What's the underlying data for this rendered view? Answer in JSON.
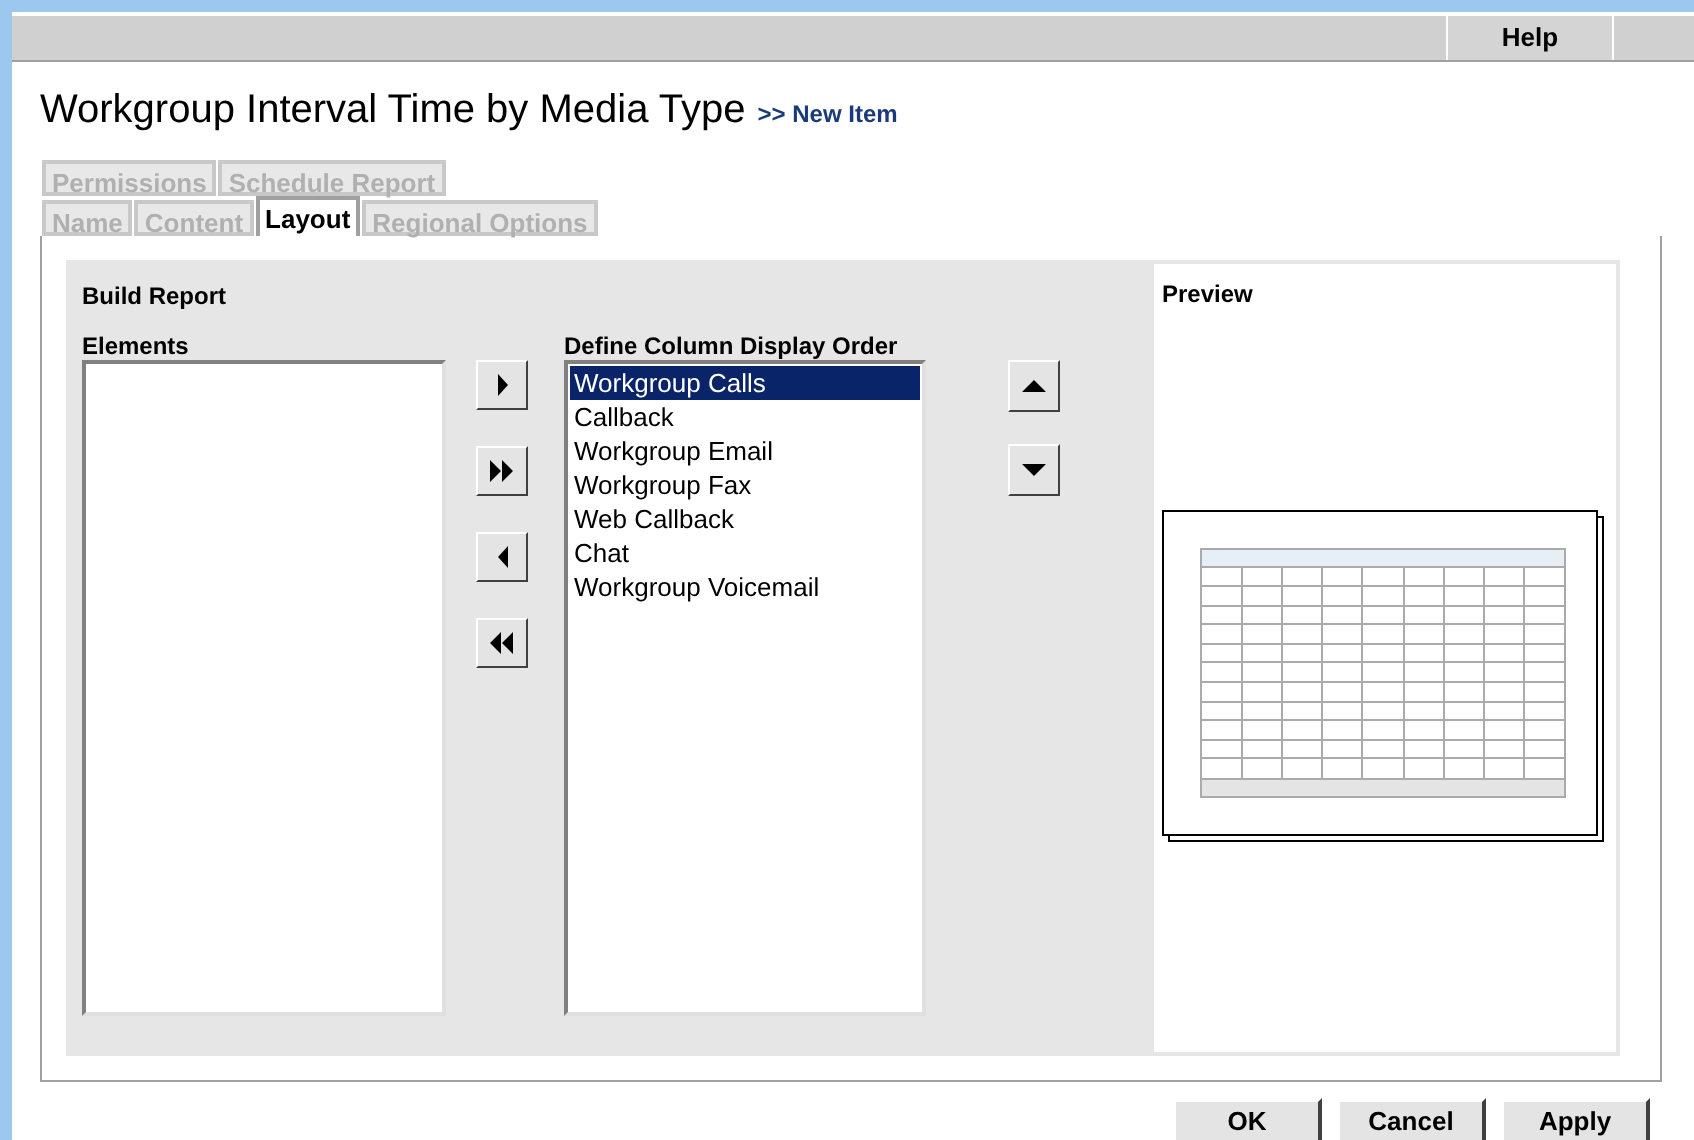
{
  "toolbar": {
    "help": "Help"
  },
  "title": "Workgroup Interval Time by Media Type",
  "breadcrumb": ">> New Item",
  "tab_rows": [
    [
      {
        "label": "Permissions",
        "selected": false
      },
      {
        "label": "Schedule Report",
        "selected": false
      }
    ],
    [
      {
        "label": "Name",
        "selected": false
      },
      {
        "label": "Content",
        "selected": false
      },
      {
        "label": "Layout",
        "selected": true
      },
      {
        "label": "Regional Options",
        "selected": false
      }
    ]
  ],
  "build_report": {
    "heading": "Build Report",
    "elements_label": "Elements",
    "order_label": "Define Column Display Order",
    "columns": [
      {
        "label": "Workgroup Calls",
        "selected": true
      },
      {
        "label": "Callback",
        "selected": false
      },
      {
        "label": "Workgroup Email",
        "selected": false
      },
      {
        "label": "Workgroup Fax",
        "selected": false
      },
      {
        "label": "Web Callback",
        "selected": false
      },
      {
        "label": "Chat",
        "selected": false
      },
      {
        "label": "Workgroup Voicemail",
        "selected": false
      }
    ]
  },
  "preview": {
    "label": "Preview"
  },
  "buttons": [
    "OK",
    "Cancel",
    "Apply"
  ]
}
